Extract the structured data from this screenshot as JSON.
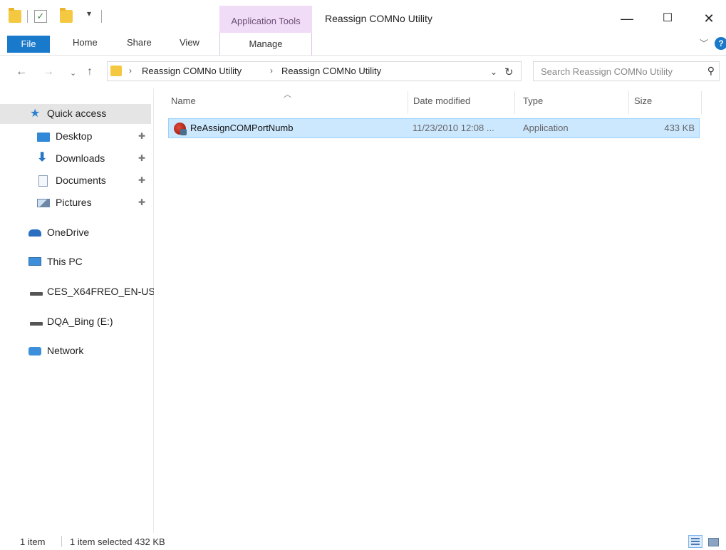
{
  "titlebar": {
    "contextual_tab_group": "Application Tools",
    "window_title": "Reassign COMNo Utility",
    "minimize_label": "—",
    "maximize_label": "☐",
    "close_label": "✕"
  },
  "ribbon": {
    "tabs": [
      "File",
      "Home",
      "Share",
      "View"
    ],
    "contextual_tab": "Manage"
  },
  "address": {
    "breadcrumbs": [
      "Reassign COMNo Utility",
      "Reassign COMNo Utility"
    ],
    "separator": "›"
  },
  "search": {
    "placeholder": "Search Reassign COMNo Utility"
  },
  "nav": {
    "items": [
      {
        "label": "Quick access",
        "icon": "star-icon"
      },
      {
        "label": "Desktop",
        "icon": "desktop-icon",
        "pinned": true
      },
      {
        "label": "Downloads",
        "icon": "download-arrow-icon",
        "pinned": true
      },
      {
        "label": "Documents",
        "icon": "document-icon",
        "pinned": true
      },
      {
        "label": "Pictures",
        "icon": "pictures-icon",
        "pinned": true
      },
      {
        "label": "OneDrive",
        "icon": "cloud-icon"
      },
      {
        "label": "This PC",
        "icon": "monitor-icon"
      },
      {
        "label": "CES_X64FREO_EN-US",
        "icon": "drive-icon"
      },
      {
        "label": "DQA_Bing (E:)",
        "icon": "drive-icon"
      },
      {
        "label": "Network",
        "icon": "network-icon"
      }
    ]
  },
  "filelist": {
    "columns": [
      "Name",
      "Date modified",
      "Type",
      "Size"
    ],
    "rows": [
      {
        "name": "ReAssignCOMPortNumb",
        "date": "11/23/2010 12:08 ...",
        "type": "Application",
        "size": "433 KB",
        "selected": true
      }
    ]
  },
  "status": {
    "item_count": "1 item",
    "selection": "1 item selected  432 KB"
  },
  "colors": {
    "accent": "#1979ca",
    "selection_bg": "#cce8ff",
    "contextual_tab_bg": "#f1dcf7",
    "folder": "#f5c842"
  }
}
